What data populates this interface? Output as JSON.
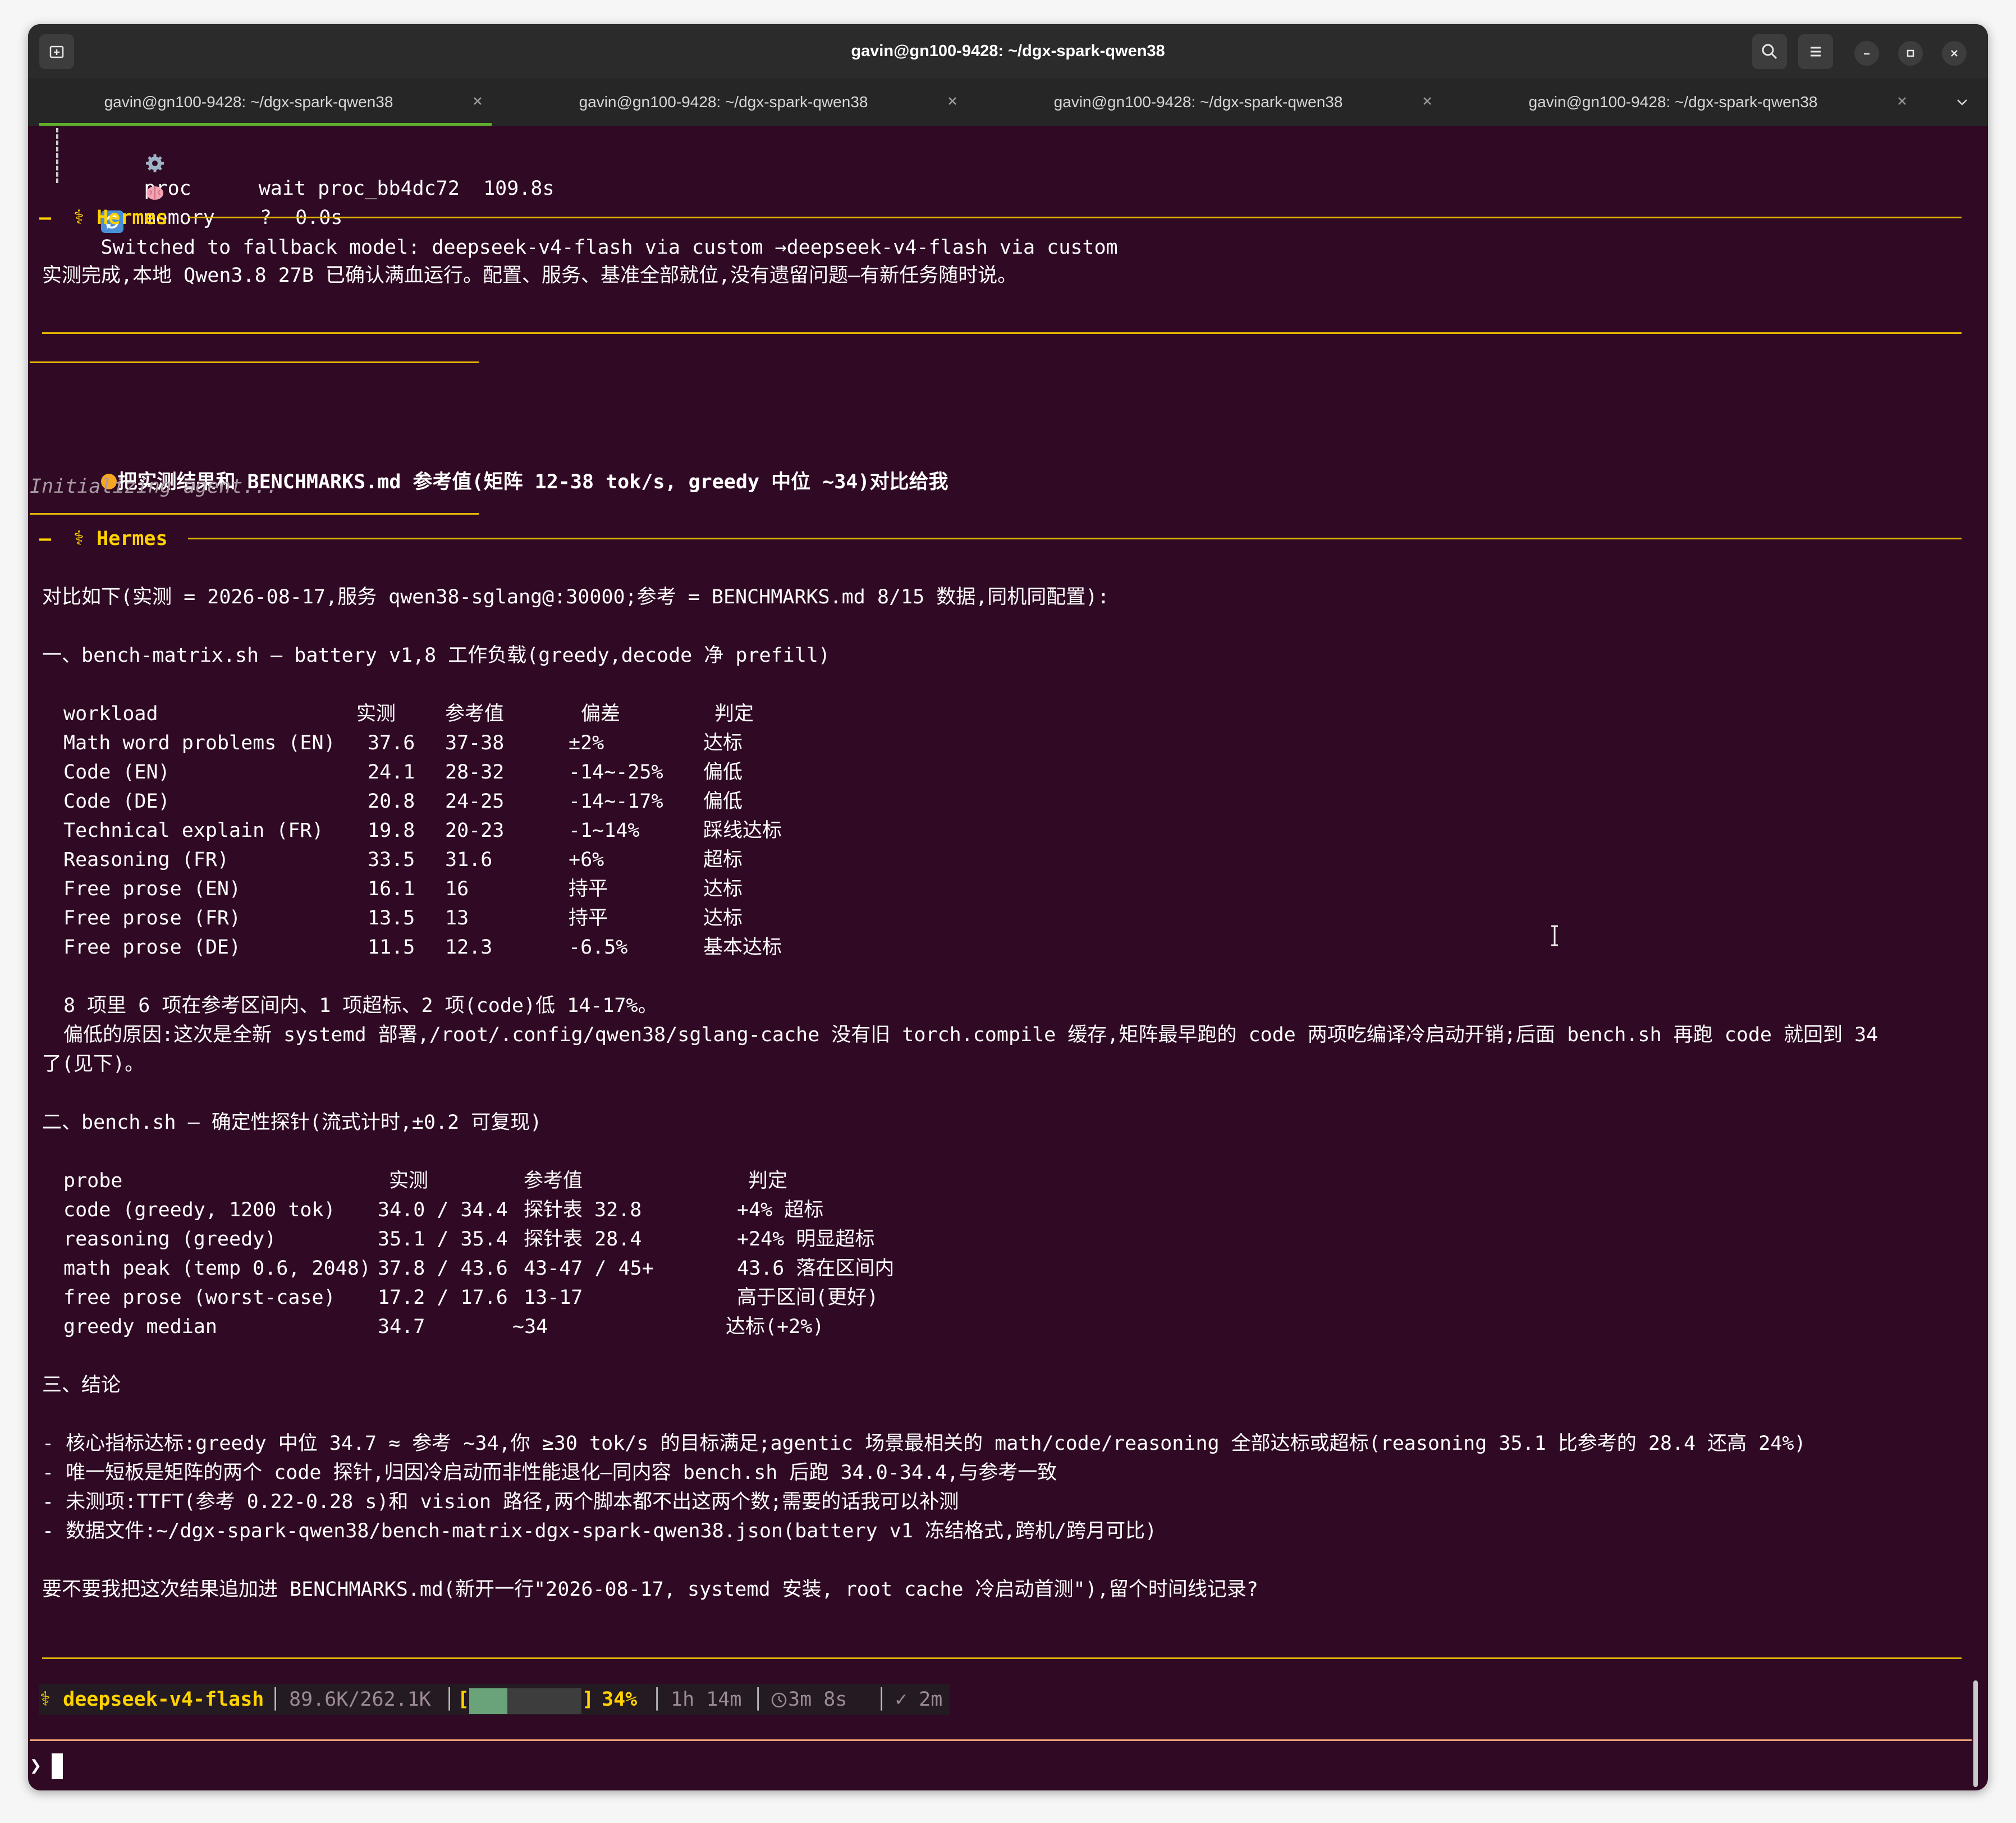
{
  "window": {
    "title": "gavin@gn100-9428: ~/dgx-spark-qwen38"
  },
  "tabs": [
    {
      "label": "gavin@gn100-9428: ~/dgx-spark-qwen38"
    },
    {
      "label": "gavin@gn100-9428: ~/dgx-spark-qwen38"
    },
    {
      "label": "gavin@gn100-9428: ~/dgx-spark-qwen38"
    },
    {
      "label": "gavin@gn100-9428: ~/dgx-spark-qwen38"
    }
  ],
  "colors": {
    "background": "#300a24",
    "accent": "#ffd200",
    "rule": "#e3b400",
    "tab_active": "#5faf2c",
    "prompt_rule": "#f0a37a"
  },
  "terminal": {
    "proc": {
      "icon": "gear-icon",
      "name": "proc",
      "status": "wait proc_bb4dc72  109.8s"
    },
    "memory": {
      "icon": "brain-icon",
      "name": "memory",
      "status": "?  0.0s"
    },
    "fallback": {
      "icon": "refresh-icon",
      "text": "Switched to fallback model: deepseek-v4-flash via custom →deepseek-v4-flash via custom"
    },
    "hermes1": {
      "label": "⚕ Hermes"
    },
    "reply1": "实测完成,本地 Qwen3.8 27B 已确认满血运行。配置、服务、基准全部就位,没有遗留问题—有新任务随时说。",
    "user_msg": "把实测结果和 BENCHMARKS.md 参考值(矩阵 12-38 tok/s, greedy 中位 ~34)对比给我",
    "init": "Initializing agent...",
    "hermes2": {
      "label": "⚕ Hermes"
    },
    "intro": "对比如下(实测 = 2026-08-17,服务 qwen38-sglang@:30000;参考 = BENCHMARKS.md 8/15 数据,同机同配置):",
    "section1": "一、bench-matrix.sh — battery v1,8 工作负载(greedy,decode 净 prefill)",
    "table1": {
      "headers": [
        "workload",
        "实测",
        "参考值",
        "偏差",
        "判定"
      ],
      "rows": [
        [
          "Math word problems (EN)",
          "37.6",
          "37-38",
          "±2%",
          "达标"
        ],
        [
          "Code (EN)",
          "24.1",
          "28-32",
          "-14~-25%",
          "偏低"
        ],
        [
          "Code (DE)",
          "20.8",
          "24-25",
          "-14~-17%",
          "偏低"
        ],
        [
          "Technical explain (FR)",
          "19.8",
          "20-23",
          "-1~14%",
          "踩线达标"
        ],
        [
          "Reasoning (FR)",
          "33.5",
          "31.6",
          "+6%",
          "超标"
        ],
        [
          "Free prose (EN)",
          "16.1",
          "16",
          "持平",
          "达标"
        ],
        [
          "Free prose (FR)",
          "13.5",
          "13",
          "持平",
          "达标"
        ],
        [
          "Free prose (DE)",
          "11.5",
          "12.3",
          "-6.5%",
          "基本达标"
        ]
      ]
    },
    "summary1": "8 项里 6 项在参考区间内、1 项超标、2 项(code)低 14-17%。",
    "reason_line1": "偏低的原因:这次是全新 systemd 部署,/root/.config/qwen38/sglang-cache 没有旧 torch.compile 缓存,矩阵最早跑的 code 两项吃编译冷启动开销;后面 bench.sh 再跑 code 就回到 34",
    "reason_line2": "了(见下)。",
    "section2": "二、bench.sh — 确定性探针(流式计时,±0.2 可复现)",
    "table2": {
      "headers": [
        "probe",
        "实测",
        "参考值",
        "判定"
      ],
      "rows": [
        [
          "code (greedy, 1200 tok)",
          "34.0 / 34.4",
          "探针表 32.8",
          "+4% 超标"
        ],
        [
          "reasoning (greedy)",
          "35.1 / 35.4",
          "探针表 28.4",
          "+24% 明显超标"
        ],
        [
          "math peak (temp 0.6, 2048)",
          "37.8 / 43.6",
          "43-47 / 45+",
          "43.6 落在区间内"
        ],
        [
          "free prose (worst-case)",
          "17.2 / 17.6",
          "13-17",
          "高于区间(更好)"
        ],
        [
          "greedy median",
          "34.7",
          "~34",
          "达标(+2%)"
        ]
      ]
    },
    "section3": "三、结论",
    "bullets": [
      "- 核心指标达标:greedy 中位 34.7 ≈ 参考 ~34,你 ≥30 tok/s 的目标满足;agentic 场景最相关的 math/code/reasoning 全部达标或超标(reasoning 35.1 比参考的 28.4 还高 24%)",
      "- 唯一短板是矩阵的两个 code 探针,归因冷启动而非性能退化—同内容 bench.sh 后跑 34.0-34.4,与参考一致",
      "- 未测项:TTFT(参考 0.22-0.28 s)和 vision 路径,两个脚本都不出这两个数;需要的话我可以补测",
      "- 数据文件:~/dgx-spark-qwen38/bench-matrix-dgx-spark-qwen38.json(battery v1 冻结格式,跨机/跨月可比)"
    ],
    "question": "要不要我把这次结果追加进 BENCHMARKS.md(新开一行\"2026-08-17, systemd 安装, root cache 冷启动首测\"),留个时间线记录?"
  },
  "status": {
    "model": "⚕ deepseek-v4-flash",
    "tokens": "89.6K/262.1K",
    "bar_open": "[",
    "bar_close": "]",
    "context_pct": "34%",
    "context_fraction": 0.34,
    "duration": "1h 14m",
    "timer": "3m 8s",
    "check": "✓ 2m"
  },
  "prompt": {
    "symbol": "❯"
  }
}
